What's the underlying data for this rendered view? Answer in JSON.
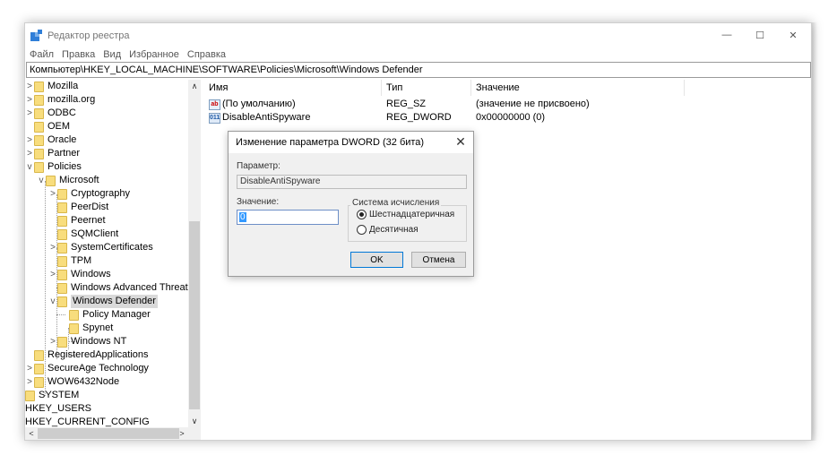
{
  "window": {
    "title": "Редактор реестра",
    "controls": {
      "minimize": "—",
      "maximize": "☐",
      "close": "✕"
    }
  },
  "menu": [
    "Файл",
    "Правка",
    "Вид",
    "Избранное",
    "Справка"
  ],
  "address": "Компьютер\\HKEY_LOCAL_MACHINE\\SOFTWARE\\Policies\\Microsoft\\Windows Defender",
  "tree": {
    "items": [
      {
        "label": "Mozilla",
        "chevron": ">"
      },
      {
        "label": "mozilla.org",
        "chevron": ">"
      },
      {
        "label": "ODBC",
        "chevron": ">"
      },
      {
        "label": "OEM",
        "chevron": ""
      },
      {
        "label": "Oracle",
        "chevron": ">"
      },
      {
        "label": "Partner",
        "chevron": ">"
      },
      {
        "label": "Policies",
        "chevron": "v"
      },
      {
        "label": "Microsoft",
        "chevron": "v"
      },
      {
        "label": "Cryptography",
        "chevron": ">"
      },
      {
        "label": "PeerDist",
        "chevron": ""
      },
      {
        "label": "Peernet",
        "chevron": ""
      },
      {
        "label": "SQMClient",
        "chevron": ""
      },
      {
        "label": "SystemCertificates",
        "chevron": ">"
      },
      {
        "label": "TPM",
        "chevron": ""
      },
      {
        "label": "Windows",
        "chevron": ">"
      },
      {
        "label": "Windows Advanced Threat Pr",
        "chevron": ""
      },
      {
        "label": "Windows Defender",
        "chevron": "v"
      },
      {
        "label": "Policy Manager",
        "chevron": ""
      },
      {
        "label": "Spynet",
        "chevron": ""
      },
      {
        "label": "Windows NT",
        "chevron": ">"
      },
      {
        "label": "RegisteredApplications",
        "chevron": ""
      },
      {
        "label": "SecureAge Technology",
        "chevron": ">"
      },
      {
        "label": "WOW6432Node",
        "chevron": ">"
      },
      {
        "label": "SYSTEM",
        "chevron": ">"
      },
      {
        "label": "HKEY_USERS",
        "chevron": ">"
      },
      {
        "label": "HKEY_CURRENT_CONFIG",
        "chevron": ">"
      }
    ]
  },
  "list": {
    "headers": {
      "name": "Имя",
      "type": "Тип",
      "data": "Значение"
    },
    "rows": [
      {
        "icon": "ab",
        "name": "(По умолчанию)",
        "type": "REG_SZ",
        "data": "(значение не присвоено)"
      },
      {
        "icon": "011",
        "name": "DisableAntiSpyware",
        "type": "REG_DWORD",
        "data": "0x00000000 (0)"
      }
    ]
  },
  "dialog": {
    "title": "Изменение параметра DWORD (32 бита)",
    "close": "✕",
    "param_label": "Параметр:",
    "param_value": "DisableAntiSpyware",
    "value_label": "Значение:",
    "value": "0",
    "base_label": "Система исчисления",
    "base_options": [
      "Шестнадцатеричная",
      "Десятичная"
    ],
    "base_selected": "Шестнадцатеричная",
    "ok": "OK",
    "cancel": "Отмена"
  },
  "colors": {
    "folder": "#f8dd7d",
    "selection": "#d9d9d9",
    "accent": "#0078d7"
  },
  "icons": {
    "app": "registry-editor-icon",
    "string_value": "reg-sz-icon",
    "dword_value": "reg-dword-icon"
  }
}
